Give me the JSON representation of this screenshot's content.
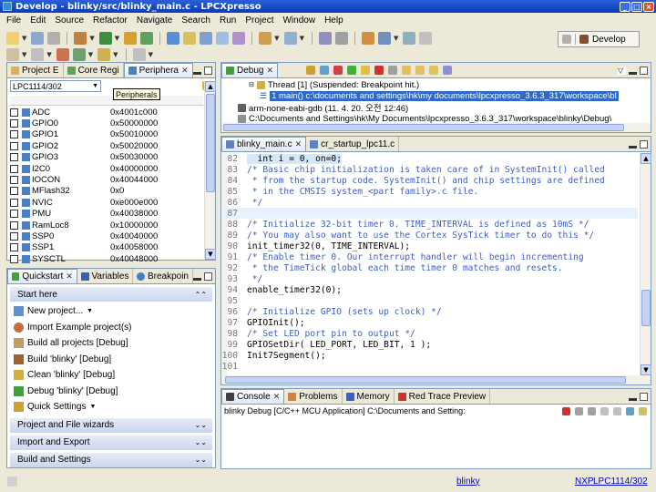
{
  "window": {
    "title": "Develop - blinky/src/blinky_main.c - LPCXpresso"
  },
  "menu": [
    "File",
    "Edit",
    "Source",
    "Refactor",
    "Navigate",
    "Search",
    "Run",
    "Project",
    "Window",
    "Help"
  ],
  "perspective": {
    "label": "Develop"
  },
  "left_top_tabs": [
    {
      "label": "Project E",
      "active": false
    },
    {
      "label": "Core Regi",
      "active": false
    },
    {
      "label": "Periphera",
      "active": true
    }
  ],
  "peripherals": {
    "selector": "LPC1114/302",
    "tooltip": "Peripherals",
    "items": [
      {
        "name": "ADC",
        "addr": "0x4001c000"
      },
      {
        "name": "GPIO0",
        "addr": "0x50000000"
      },
      {
        "name": "GPIO1",
        "addr": "0x50010000"
      },
      {
        "name": "GPIO2",
        "addr": "0x50020000"
      },
      {
        "name": "GPIO3",
        "addr": "0x50030000"
      },
      {
        "name": "I2C0",
        "addr": "0x40000000"
      },
      {
        "name": "IOCON",
        "addr": "0x40044000"
      },
      {
        "name": "MFlash32",
        "addr": "0x0"
      },
      {
        "name": "NVIC",
        "addr": "0xe000e000"
      },
      {
        "name": "PMU",
        "addr": "0x40038000"
      },
      {
        "name": "RamLoc8",
        "addr": "0x10000000"
      },
      {
        "name": "SSP0",
        "addr": "0x40040000"
      },
      {
        "name": "SSP1",
        "addr": "0x40058000"
      },
      {
        "name": "SYSCTL",
        "addr": "0x40048000"
      }
    ]
  },
  "left_bottom_tabs": [
    {
      "label": "Quickstart",
      "active": true
    },
    {
      "label": "Variables",
      "active": false
    },
    {
      "label": "Breakpoin",
      "active": false
    }
  ],
  "quickstart": {
    "start_here": "Start here",
    "items": [
      "New project...",
      "Import Example project(s)",
      "Build all projects [Debug]",
      "Build 'blinky' [Debug]",
      "Clean 'blinky' [Debug]",
      "Debug 'blinky' [Debug]",
      "Quick Settings"
    ],
    "sections": [
      "Project and File wizards",
      "Import and Export",
      "Build and Settings"
    ]
  },
  "debug": {
    "tab": "Debug",
    "rows": [
      "Thread [1] (Suspended: Breakpoint hit.)",
      "1 main() c:\\documents and settings\\hk\\my documents\\lpcxpresso_3.6.3_317\\workspace\\bl",
      "arm-none-eabi-gdb (11. 4. 20. 오전 12:46)",
      "C:\\Documents and Settings\\hk\\My Documents\\lpcxpresso_3.6.3_317\\workspace\\blinky\\Debug\\"
    ]
  },
  "editor": {
    "tabs": [
      {
        "label": "blinky_main.c",
        "active": true
      },
      {
        "label": "cr_startup_lpc11.c",
        "active": false
      }
    ],
    "lines": [
      {
        "n": "82",
        "text": "  int i = 0, on=0;",
        "type": "code",
        "hl": true
      },
      {
        "n": "83",
        "text": "/* Basic chip initialization is taken care of in SystemInit() called",
        "type": "comment"
      },
      {
        "n": "84",
        "text": " * from the startup code. SystemInit() and chip settings are defined",
        "type": "comment"
      },
      {
        "n": "85",
        "text": " * in the CMSIS system_<part family>.c file.",
        "type": "comment"
      },
      {
        "n": "86",
        "text": " */",
        "type": "comment"
      },
      {
        "n": "87",
        "text": "",
        "type": "code",
        "cur": true
      },
      {
        "n": "88",
        "text": "/* Initialize 32-bit timer 0. TIME_INTERVAL is defined as 10mS */",
        "type": "comment"
      },
      {
        "n": "89",
        "text": "/* You may also want to use the Cortex SysTick timer to do this */",
        "type": "comment"
      },
      {
        "n": "90",
        "text": "init_timer32(0, TIME_INTERVAL);",
        "type": "code"
      },
      {
        "n": "91",
        "text": "/* Enable timer 0. Our interrupt handler will begin incrementing",
        "type": "comment"
      },
      {
        "n": "92",
        "text": " * the TimeTick global each time timer 0 matches and resets.",
        "type": "comment"
      },
      {
        "n": "93",
        "text": " */",
        "type": "comment"
      },
      {
        "n": "94",
        "text": "enable_timer32(0);",
        "type": "code"
      },
      {
        "n": "95",
        "text": "",
        "type": "code"
      },
      {
        "n": "96",
        "text": "/* Initialize GPIO (sets up clock) */",
        "type": "comment"
      },
      {
        "n": "97",
        "text": "GPIOInit();",
        "type": "code"
      },
      {
        "n": "98",
        "text": "/* Set LED port pin to output */",
        "type": "comment"
      },
      {
        "n": "99",
        "text": "GPIOSetDir( LED_PORT, LED_BIT, 1 );",
        "type": "code"
      },
      {
        "n": "100",
        "text": "Init7Segment();",
        "type": "code"
      },
      {
        "n": "101",
        "text": "",
        "type": "code"
      }
    ]
  },
  "console": {
    "tabs": [
      {
        "label": "Console",
        "active": true
      },
      {
        "label": "Problems",
        "active": false
      },
      {
        "label": "Memory",
        "active": false
      },
      {
        "label": "Red Trace Preview",
        "active": false
      }
    ],
    "line": "blinky Debug [C/C++ MCU Application] C:\\Documents and Setting:"
  },
  "status": {
    "project": "blinky",
    "vendor": "NXP",
    "part": "LPC1114/302"
  }
}
